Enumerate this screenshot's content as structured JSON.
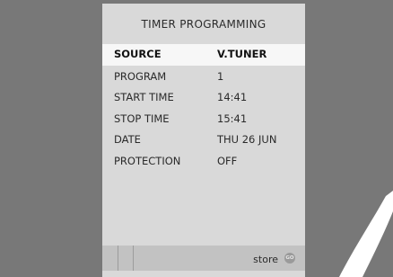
{
  "menu": {
    "title": "TIMER  PROGRAMMING",
    "rows": [
      {
        "label": "SOURCE",
        "value": "V.TUNER",
        "selected": true
      },
      {
        "label": "PROGRAM",
        "value": "1"
      },
      {
        "label": "START TIME",
        "value": "14:41"
      },
      {
        "label": "STOP TIME",
        "value": "15:41"
      },
      {
        "label": "DATE",
        "value": "THU  26 JUN"
      },
      {
        "label": "PROTECTION",
        "value": "OFF"
      }
    ]
  },
  "statusbar": {
    "store_label": "store",
    "go_icon": "GO"
  },
  "colors": {
    "background": "#787878",
    "menu": "#d9d9d9",
    "selected_row": "#f7f7f7",
    "statusbar": "#c2c2c2"
  }
}
